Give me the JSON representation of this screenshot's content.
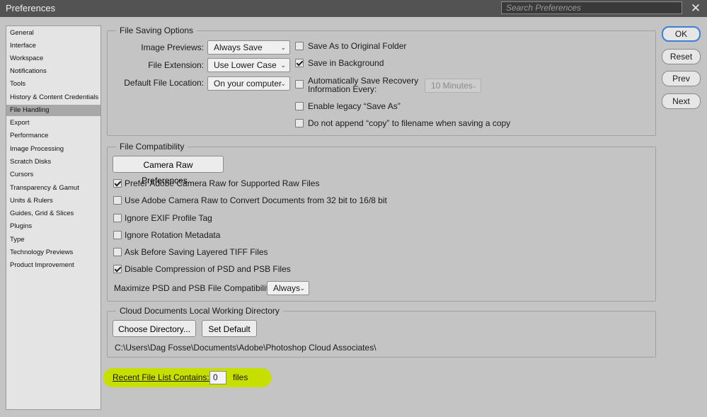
{
  "window": {
    "title": "Preferences",
    "search_placeholder": "Search Preferences",
    "close_glyph": "✕"
  },
  "sidebar": {
    "items": [
      {
        "label": "General"
      },
      {
        "label": "Interface"
      },
      {
        "label": "Workspace"
      },
      {
        "label": "Notifications"
      },
      {
        "label": "Tools"
      },
      {
        "label": "History & Content Credentials"
      },
      {
        "label": "File Handling",
        "selected": true
      },
      {
        "label": "Export"
      },
      {
        "label": "Performance"
      },
      {
        "label": "Image Processing"
      },
      {
        "label": "Scratch Disks"
      },
      {
        "label": "Cursors"
      },
      {
        "label": "Transparency & Gamut"
      },
      {
        "label": "Units & Rulers"
      },
      {
        "label": "Guides, Grid & Slices"
      },
      {
        "label": "Plugins"
      },
      {
        "label": "Type"
      },
      {
        "label": "Technology Previews"
      },
      {
        "label": "Product Improvement"
      }
    ]
  },
  "file_saving": {
    "legend": "File Saving Options",
    "image_previews_label": "Image Previews:",
    "image_previews_value": "Always Save",
    "file_extension_label": "File Extension:",
    "file_extension_value": "Use Lower Case",
    "default_location_label": "Default File Location:",
    "default_location_value": "On your computer",
    "save_as_original": {
      "label": "Save As to Original Folder",
      "checked": false
    },
    "save_in_background": {
      "label": "Save in Background",
      "checked": true
    },
    "auto_save_recovery": {
      "label_line1": "Automatically Save Recovery",
      "label_line2": "Information Every:",
      "checked": false
    },
    "auto_save_interval": "10 Minutes",
    "legacy_save_as": {
      "label": "Enable legacy “Save As”",
      "checked": false
    },
    "no_append_copy": {
      "label": "Do not append “copy” to filename when saving a copy",
      "checked": false
    }
  },
  "file_compat": {
    "legend": "File Compatibility",
    "camera_raw_button": "Camera Raw Preferences...",
    "prefer_acr": {
      "label": "Prefer Adobe Camera Raw for Supported Raw Files",
      "checked": true
    },
    "use_acr_convert": {
      "label": "Use Adobe Camera Raw to Convert Documents from 32 bit to 16/8 bit",
      "checked": false
    },
    "ignore_exif": {
      "label": "Ignore EXIF Profile Tag",
      "checked": false
    },
    "ignore_rotation": {
      "label": "Ignore Rotation Metadata",
      "checked": false
    },
    "ask_tiff": {
      "label": "Ask Before Saving Layered TIFF Files",
      "checked": false
    },
    "disable_compression": {
      "label": "Disable Compression of PSD and PSB Files",
      "checked": true
    },
    "maximize_label": "Maximize PSD and PSB File Compatibility:",
    "maximize_value": "Always"
  },
  "cloud": {
    "legend": "Cloud Documents Local Working Directory",
    "choose_button": "Choose Directory...",
    "default_button": "Set Default",
    "path": "C:\\Users\\Dag Fosse\\Documents\\Adobe\\Photoshop Cloud Associates\\"
  },
  "recent": {
    "label": "Recent File List Contains:",
    "value": "0",
    "suffix": "files"
  },
  "actions": {
    "ok": "OK",
    "reset": "Reset",
    "prev": "Prev",
    "next": "Next"
  },
  "colors": {
    "highlight": "#c6de00",
    "ok_border": "#3d7fd6",
    "dialog_bg": "#c4c4c4"
  }
}
